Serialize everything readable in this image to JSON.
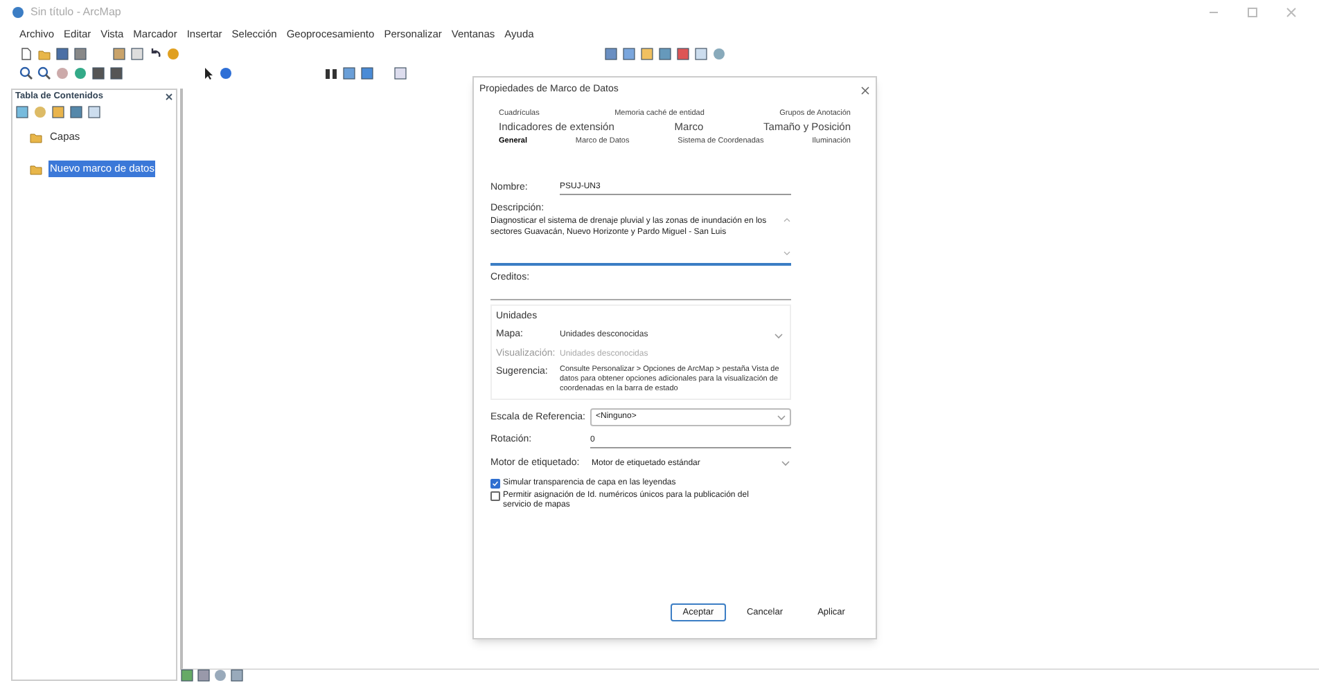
{
  "window": {
    "title": "Sin título - ArcMap"
  },
  "menu": [
    "Archivo",
    "Editar",
    "Vista",
    "Marcador",
    "Insertar",
    "Selección",
    "Geoprocesamiento",
    "Personalizar",
    "Ventanas",
    "Ayuda"
  ],
  "toc": {
    "title": "Tabla de Contenidos",
    "items": [
      {
        "label": "Capas",
        "selected": false
      },
      {
        "label": "Nuevo marco de datos",
        "selected": true
      }
    ]
  },
  "dialog": {
    "title": "Propiedades de Marco de Datos",
    "tab_rows": [
      [
        {
          "label": "Cuadrículas",
          "selected": false
        },
        {
          "label": "Memoria caché de entidad",
          "selected": false
        },
        {
          "label": "Grupos de Anotación",
          "selected": false
        }
      ],
      [
        {
          "label": "Indicadores de extensión",
          "selected": false
        },
        {
          "label": "Marco",
          "selected": false
        },
        {
          "label": "Tamaño y Posición",
          "selected": false
        }
      ],
      [
        {
          "label": "General",
          "selected": true
        },
        {
          "label": "Marco de Datos",
          "selected": false
        },
        {
          "label": "Sistema de Coordenadas",
          "selected": false
        },
        {
          "label": "Iluminación",
          "selected": false
        }
      ]
    ],
    "name": {
      "label": "Nombre:",
      "value": "PSUJ-UN3"
    },
    "description": {
      "label": "Descripción:",
      "value": "Diagnosticar el sistema de drenaje pluvial y las zonas de inundación en los sectores Guavacán, Nuevo Horizonte y Pardo Miguel - San Luis"
    },
    "credits": {
      "label": "Creditos:"
    },
    "units": {
      "title": "Unidades",
      "rows": [
        {
          "label": "Mapa:",
          "value": "Unidades desconocidas",
          "disabled": false
        },
        {
          "label": "Visualización:",
          "value": "Unidades desconocidas",
          "disabled": true
        }
      ],
      "hint_label": "Sugerencia:",
      "hint": "Consulte Personalizar > Opciones de ArcMap > pestaña Vista de datos para obtener opciones adicionales para la visualización de coordenadas en la barra de estado"
    },
    "reference_scale": {
      "label": "Escala de Referencia:",
      "value": "<Ninguno>"
    },
    "rotation": {
      "label": "Rotación:",
      "value": "0"
    },
    "labeling_engine": {
      "label": "Motor de etiquetado:",
      "value": "Motor de etiquetado estándar"
    },
    "options": [
      {
        "label": "Simular transparencia de capa en las leyendas",
        "checked": true
      },
      {
        "label": "Permitir asignación de Id. numéricos únicos para la publicación del servicio de mapas",
        "checked": false
      }
    ],
    "buttons": [
      {
        "label": "Aceptar",
        "default": true
      },
      {
        "label": "Cancelar",
        "default": false
      },
      {
        "label": "Aplicar",
        "default": false
      }
    ]
  }
}
